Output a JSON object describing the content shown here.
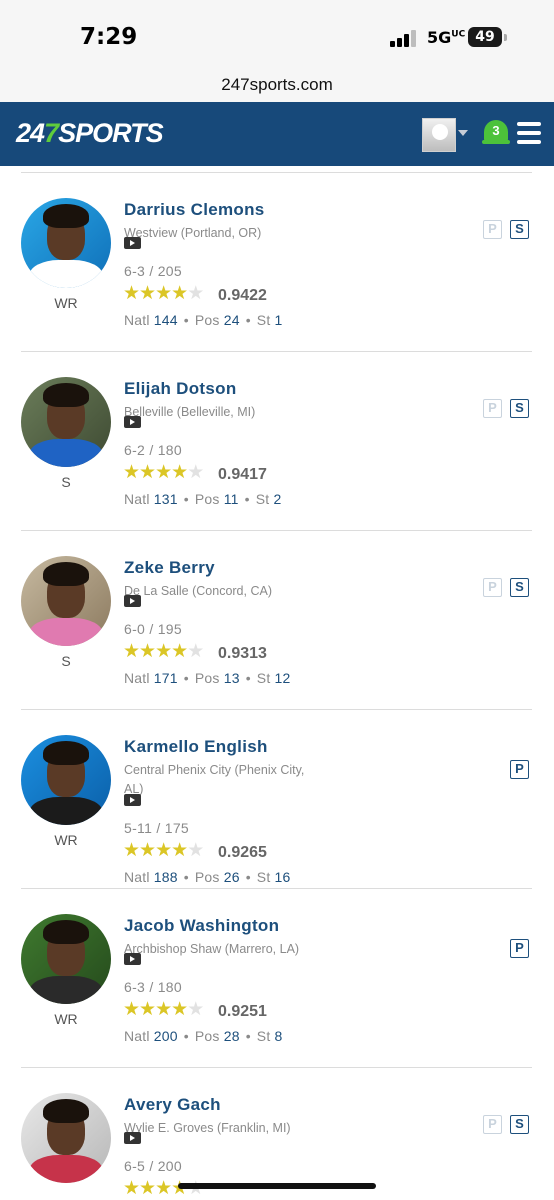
{
  "status_bar": {
    "time": "7:29",
    "network": "5G",
    "network_sup": "UC",
    "battery": "49"
  },
  "browser": {
    "url": "247sports.com"
  },
  "header": {
    "logo_num_a": "24",
    "logo_num_b": "7",
    "logo_word": "SPORTS",
    "notification_count": "3",
    "brand_color": "#17497a",
    "accent_color": "#4cc23a",
    "icons": [
      "user-avatar-icon",
      "caret-down-icon",
      "bell-icon",
      "hamburger-menu-icon"
    ]
  },
  "players": [
    {
      "name": "Darrius Clemons",
      "school": "Westview (Portland, OR)",
      "position": "WR",
      "measurements": "6-3 / 205",
      "stars": 4,
      "rating": "0.9422",
      "natl": "144",
      "pos_rank": "24",
      "state_rank": "1",
      "badges": [
        "P",
        "S"
      ],
      "p_active": false
    },
    {
      "name": "Elijah Dotson",
      "school": "Belleville (Belleville, MI)",
      "position": "S",
      "measurements": "6-2 / 180",
      "stars": 4,
      "rating": "0.9417",
      "natl": "131",
      "pos_rank": "11",
      "state_rank": "2",
      "badges": [
        "P",
        "S"
      ],
      "p_active": false
    },
    {
      "name": "Zeke Berry",
      "school": "De La Salle (Concord, CA)",
      "position": "S",
      "measurements": "6-0 / 195",
      "stars": 4,
      "rating": "0.9313",
      "natl": "171",
      "pos_rank": "13",
      "state_rank": "12",
      "badges": [
        "P",
        "S"
      ],
      "p_active": false
    },
    {
      "name": "Karmello English",
      "school": "Central Phenix City (Phenix City, AL)",
      "position": "WR",
      "measurements": "5-11 / 175",
      "stars": 4,
      "rating": "0.9265",
      "natl": "188",
      "pos_rank": "26",
      "state_rank": "16",
      "badges": [
        "P"
      ],
      "p_active": true
    },
    {
      "name": "Jacob Washington",
      "school": "Archbishop Shaw (Marrero, LA)",
      "position": "WR",
      "measurements": "6-3 / 180",
      "stars": 4,
      "rating": "0.9251",
      "natl": "200",
      "pos_rank": "28",
      "state_rank": "8",
      "badges": [
        "P"
      ],
      "p_active": true
    },
    {
      "name": "Avery Gach",
      "school": "Wylie E. Groves (Franklin, MI)",
      "position": "",
      "measurements": "6-5 / 200",
      "stars": 4,
      "rating": "",
      "natl": "",
      "pos_rank": "",
      "state_rank": "",
      "badges": [
        "P",
        "S"
      ],
      "p_active": false
    }
  ],
  "labels": {
    "natl": "Natl",
    "pos": "Pos",
    "st": "St"
  }
}
